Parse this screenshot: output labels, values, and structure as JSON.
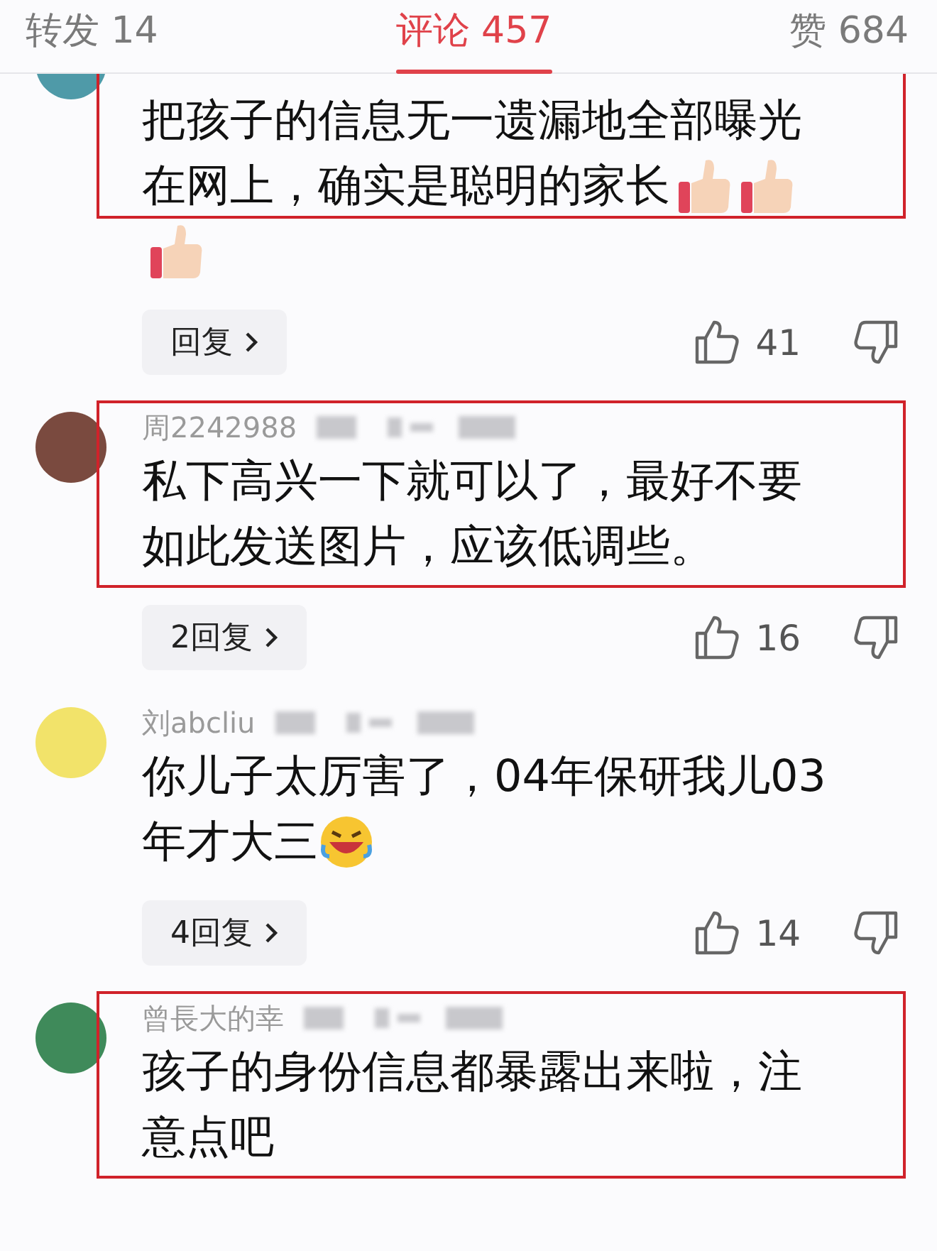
{
  "tabs": [
    {
      "label": "转发 14",
      "selected": false
    },
    {
      "label": "评论 457",
      "selected": true
    },
    {
      "label": "赞 684",
      "selected": false
    }
  ],
  "comments": [
    {
      "lines": [
        {
          "text": "把孩子的信息无一遗漏地全部曝光"
        },
        {
          "text": "在网上，确实是聪明的家长",
          "emojis": [
            {
              "kind": "thumbs_up"
            },
            {
              "kind": "thumbs_up"
            }
          ]
        },
        {
          "emojis": [
            {
              "kind": "thumbs_up"
            }
          ]
        }
      ],
      "reply": "回复",
      "likes": "41",
      "highlighted": true
    },
    {
      "name": "周2242988",
      "name_blurred": true,
      "lines": [
        {
          "text": "私下高兴一下就可以了，最好不要"
        },
        {
          "text": "如此发送图片，应该低调些。"
        }
      ],
      "reply": "2回复",
      "likes": "16",
      "highlighted": true
    },
    {
      "name": "刘abcliu",
      "name_blurred": true,
      "lines": [
        {
          "text": "你儿子太厉害了，04年保研我儿03"
        },
        {
          "text": "年才大三",
          "emojis": [
            {
              "kind": "laughing"
            }
          ]
        }
      ],
      "reply": "4回复",
      "likes": "14",
      "highlighted": false
    },
    {
      "name": "曾長大的幸",
      "name_blurred": true,
      "lines": [
        {
          "text": "孩子的身份信息都暴露出来啦，注"
        },
        {
          "text": "意点吧"
        }
      ],
      "highlighted": true
    }
  ]
}
